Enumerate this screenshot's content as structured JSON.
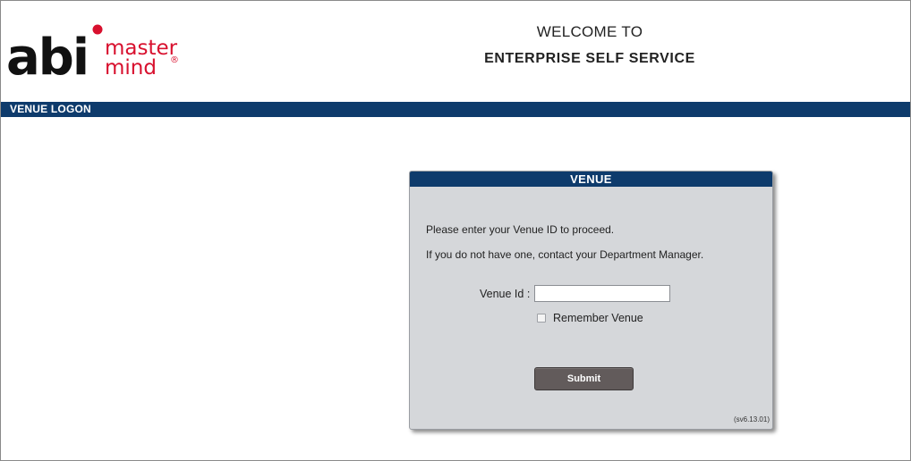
{
  "logo": {
    "word": "abi",
    "tagline_line1": "master",
    "tagline_line2": "mind",
    "registered": "®",
    "brand_red": "#d8102e",
    "brand_dark": "#111111"
  },
  "header": {
    "welcome_line1": "WELCOME TO",
    "welcome_line2": "ENTERPRISE SELF SERVICE"
  },
  "bar": {
    "label": "VENUE LOGON",
    "color": "#0e3b6c"
  },
  "panel": {
    "title": "VENUE",
    "message1": "Please enter your Venue ID to proceed.",
    "message2": "If you do not have one, contact your Department Manager.",
    "venue_label": "Venue Id :",
    "venue_value": "",
    "remember_label": "Remember Venue",
    "remember_checked": false,
    "submit_label": "Submit",
    "version": "(sv6.13.01)"
  }
}
